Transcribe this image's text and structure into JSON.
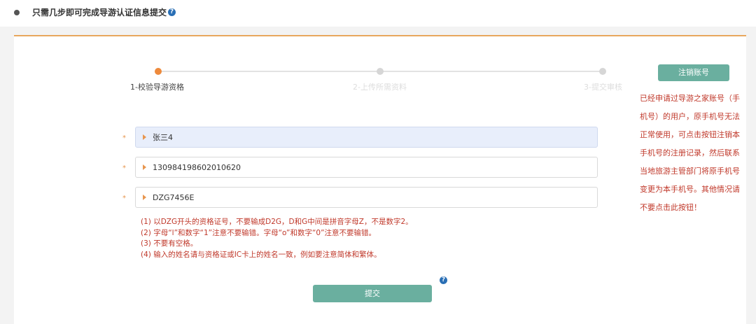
{
  "header": {
    "title": "只需几步即可完成导游认证信息提交",
    "help_glyph": "?"
  },
  "steps": [
    {
      "label": "1-校验导游资格",
      "active": true
    },
    {
      "label": "2-上传所需资料",
      "active": false
    },
    {
      "label": "3-提交审核",
      "active": false
    }
  ],
  "form": {
    "required_mark": "*",
    "name_value": "张三4",
    "id_value": "130984198602010620",
    "cert_value": "DZG7456E"
  },
  "notes": [
    "(1) 以DZG开头的资格证号，不要输成D2G，D和G中间是拼音字母Z，不是数字2。",
    "(2) 字母“l”和数字“1”注意不要输错。字母“o”和数字“0”注意不要输错。",
    "(3) 不要有空格。",
    "(4) 输入的姓名请与资格证或IC卡上的姓名一致，例如要注意简体和繁体。"
  ],
  "submit_label": "提交",
  "sidebar": {
    "cancel_label": "注销账号",
    "note_lines": [
      "已经申请过导游之家账号（手",
      "机号）的用户，原手机号无法",
      "正常使用，可点击按钮注销本",
      "手机号的注册记录，然后联系",
      "当地旅游主管部门将原手机号",
      "变更为本手机号。其他情况请",
      "不要点击此按钮！"
    ]
  },
  "colors": {
    "accent_orange": "#ee8a3c",
    "teal_button": "#6aaf9f",
    "warning_red": "#c0392b",
    "help_blue": "#2a6fb5"
  }
}
